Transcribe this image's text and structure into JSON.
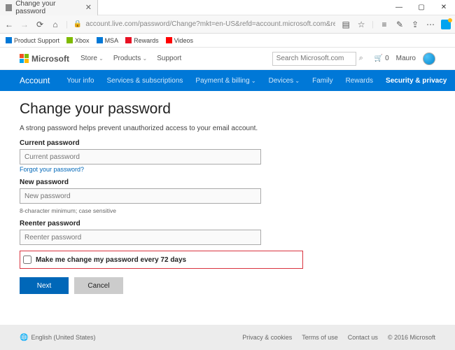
{
  "window": {
    "tab_title": "Change your password",
    "url": "account.live.com/password/Change?mkt=en-US&refd=account.microsoft.com&refp=privacy"
  },
  "favorites": [
    "Product Support",
    "Xbox",
    "MSA",
    "Rewards",
    "Videos"
  ],
  "header": {
    "brand": "Microsoft",
    "nav": [
      "Store",
      "Products",
      "Support"
    ],
    "search_placeholder": "Search Microsoft.com",
    "cart_count": "0",
    "user_name": "Mauro"
  },
  "account_nav": {
    "title": "Account",
    "items": [
      "Your info",
      "Services & subscriptions",
      "Payment & billing",
      "Devices",
      "Family",
      "Rewards",
      "Security & privacy"
    ],
    "active_index": 6
  },
  "page": {
    "heading": "Change your password",
    "description": "A strong password helps prevent unauthorized access to your email account.",
    "current_label": "Current password",
    "current_placeholder": "Current password",
    "forgot_link": "Forgot your password?",
    "new_label": "New password",
    "new_placeholder": "New password",
    "hint": "8-character minimum; case sensitive",
    "reenter_label": "Reenter password",
    "reenter_placeholder": "Reenter password",
    "checkbox_label": "Make me change my password every 72 days",
    "next_btn": "Next",
    "cancel_btn": "Cancel"
  },
  "footer": {
    "language": "English (United States)",
    "links": [
      "Privacy & cookies",
      "Terms of use",
      "Contact us"
    ],
    "copyright": "© 2016 Microsoft"
  }
}
